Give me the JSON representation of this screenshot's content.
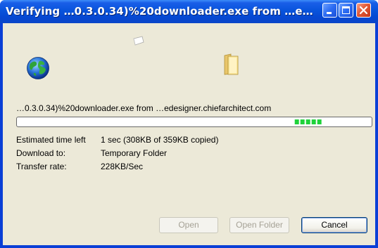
{
  "window": {
    "title": "Verifying …0.3.0.34)%20downloader.exe from …e…"
  },
  "transfer": {
    "source_line": "…0.3.0.34)%20downloader.exe from …edesigner.chiefarchitect.com",
    "progress_fraction": 0.86,
    "progress_blocks": 5
  },
  "info": {
    "time_left_label": "Estimated time left",
    "time_left_value": "1 sec (308KB of 359KB copied)",
    "download_to_label": "Download to:",
    "download_to_value": "Temporary Folder",
    "transfer_rate_label": "Transfer rate:",
    "transfer_rate_value": "228KB/Sec"
  },
  "buttons": {
    "open": "Open",
    "open_folder": "Open Folder",
    "cancel": "Cancel"
  },
  "icons": {
    "minimize": "minimize-icon",
    "maximize": "maximize-icon",
    "close": "close-icon",
    "source": "globe-icon",
    "flying": "document-icon",
    "destination": "folder-icon"
  },
  "colors": {
    "titlebar": "#0854dc",
    "dialog_face": "#ece9d8",
    "progress_block": "#1fd23a",
    "close_button": "#e25a36"
  }
}
